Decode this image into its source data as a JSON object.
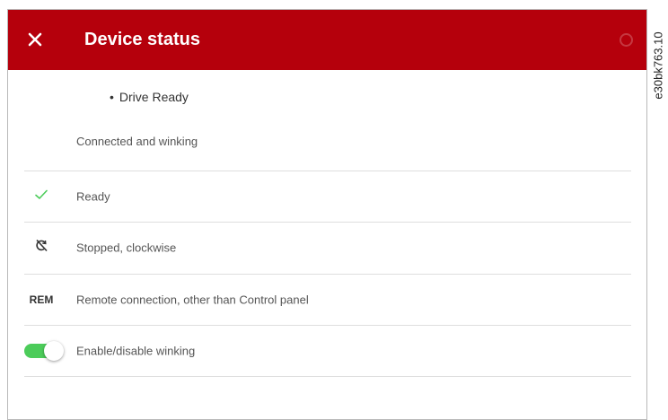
{
  "header": {
    "title": "Device status",
    "close_icon": "close-icon",
    "help_icon": "help-icon",
    "bg_color": "#b5000c"
  },
  "status": {
    "bullet": "•",
    "primary": "Drive Ready",
    "connection": "Connected and winking"
  },
  "rows": [
    {
      "icon": "check-icon",
      "label": "Ready",
      "icon_color": "#4ccc5a"
    },
    {
      "icon": "stopped-rotation-icon",
      "label": "Stopped, clockwise"
    },
    {
      "icon_text": "REM",
      "label": "Remote connection, other than Control panel"
    },
    {
      "icon": "toggle-switch",
      "label": "Enable/disable winking",
      "toggle_on": true,
      "toggle_color": "#4ccc5a"
    }
  ],
  "side_code": "e30bk763.10"
}
